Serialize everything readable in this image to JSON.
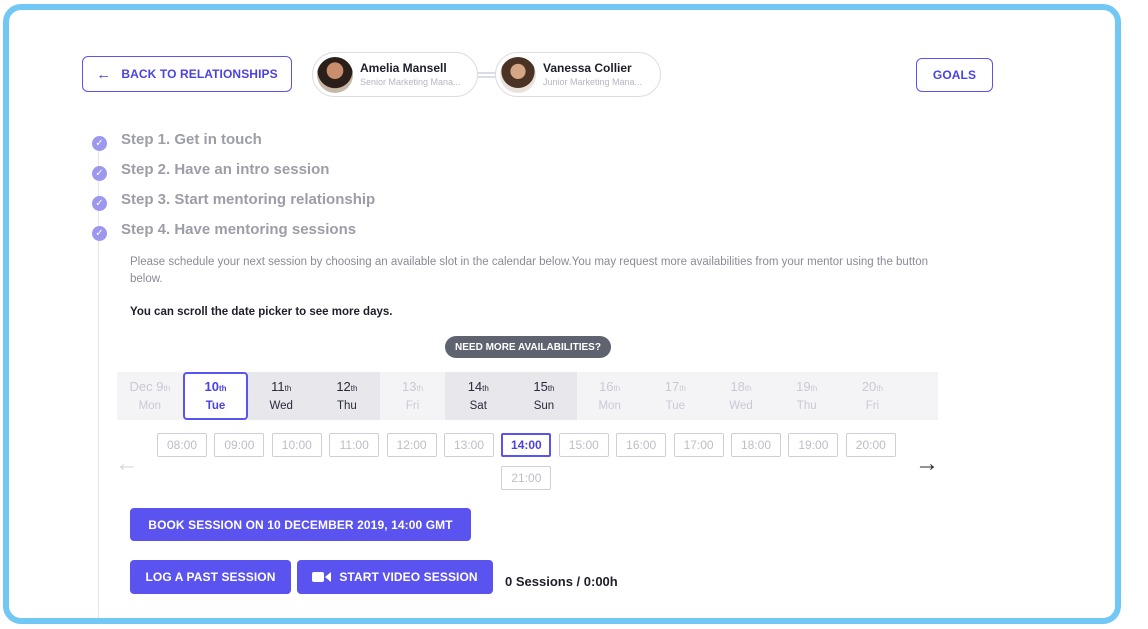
{
  "header": {
    "back_label": "BACK TO RELATIONSHIPS",
    "goals_label": "GOALS",
    "participants": [
      {
        "name": "Amelia Mansell",
        "role": "Senior Marketing Mana..."
      },
      {
        "name": "Vanessa Collier",
        "role": "Junior Marketing Mana..."
      }
    ]
  },
  "steps": [
    {
      "label": "Step 1. Get in touch"
    },
    {
      "label": "Step 2. Have an intro session"
    },
    {
      "label": "Step 3. Start mentoring relationship"
    },
    {
      "label": "Step 4. Have mentoring sessions"
    }
  ],
  "schedule": {
    "description": "Please schedule your next session by choosing an available slot in the calendar below.You may request more availabilities from your mentor using the button below.",
    "scroll_note": "You can scroll the date picker to see more days.",
    "need_more_label": "NEED MORE AVAILABILITIES?",
    "dates": [
      {
        "day": "Dec 9",
        "suffix": "th",
        "weekday": "Mon",
        "state": "disabled"
      },
      {
        "day": "10",
        "suffix": "th",
        "weekday": "Tue",
        "state": "selected"
      },
      {
        "day": "11",
        "suffix": "th",
        "weekday": "Wed",
        "state": "avail"
      },
      {
        "day": "12",
        "suffix": "th",
        "weekday": "Thu",
        "state": "avail"
      },
      {
        "day": "13",
        "suffix": "th",
        "weekday": "Fri",
        "state": "disabled"
      },
      {
        "day": "14",
        "suffix": "th",
        "weekday": "Sat",
        "state": "avail"
      },
      {
        "day": "15",
        "suffix": "th",
        "weekday": "Sun",
        "state": "avail"
      },
      {
        "day": "16",
        "suffix": "th",
        "weekday": "Mon",
        "state": "disabled"
      },
      {
        "day": "17",
        "suffix": "th",
        "weekday": "Tue",
        "state": "disabled"
      },
      {
        "day": "18",
        "suffix": "th",
        "weekday": "Wed",
        "state": "disabled"
      },
      {
        "day": "19",
        "suffix": "th",
        "weekday": "Thu",
        "state": "disabled"
      },
      {
        "day": "20",
        "suffix": "th",
        "weekday": "Fri",
        "state": "disabled"
      }
    ],
    "slots": [
      "08:00",
      "09:00",
      "10:00",
      "11:00",
      "12:00",
      "13:00",
      "14:00",
      "15:00",
      "16:00",
      "17:00",
      "18:00",
      "19:00",
      "20:00",
      "21:00"
    ],
    "selected_slot": "14:00",
    "book_label": "BOOK SESSION ON 10 DECEMBER 2019, 14:00 GMT",
    "log_label": "LOG A PAST SESSION",
    "video_label": "START VIDEO SESSION",
    "sessions_summary": "0 Sessions / 0:00h"
  },
  "colors": {
    "accent": "#5b53ef",
    "frame": "#72c8f4",
    "check": "#9d97ee"
  }
}
